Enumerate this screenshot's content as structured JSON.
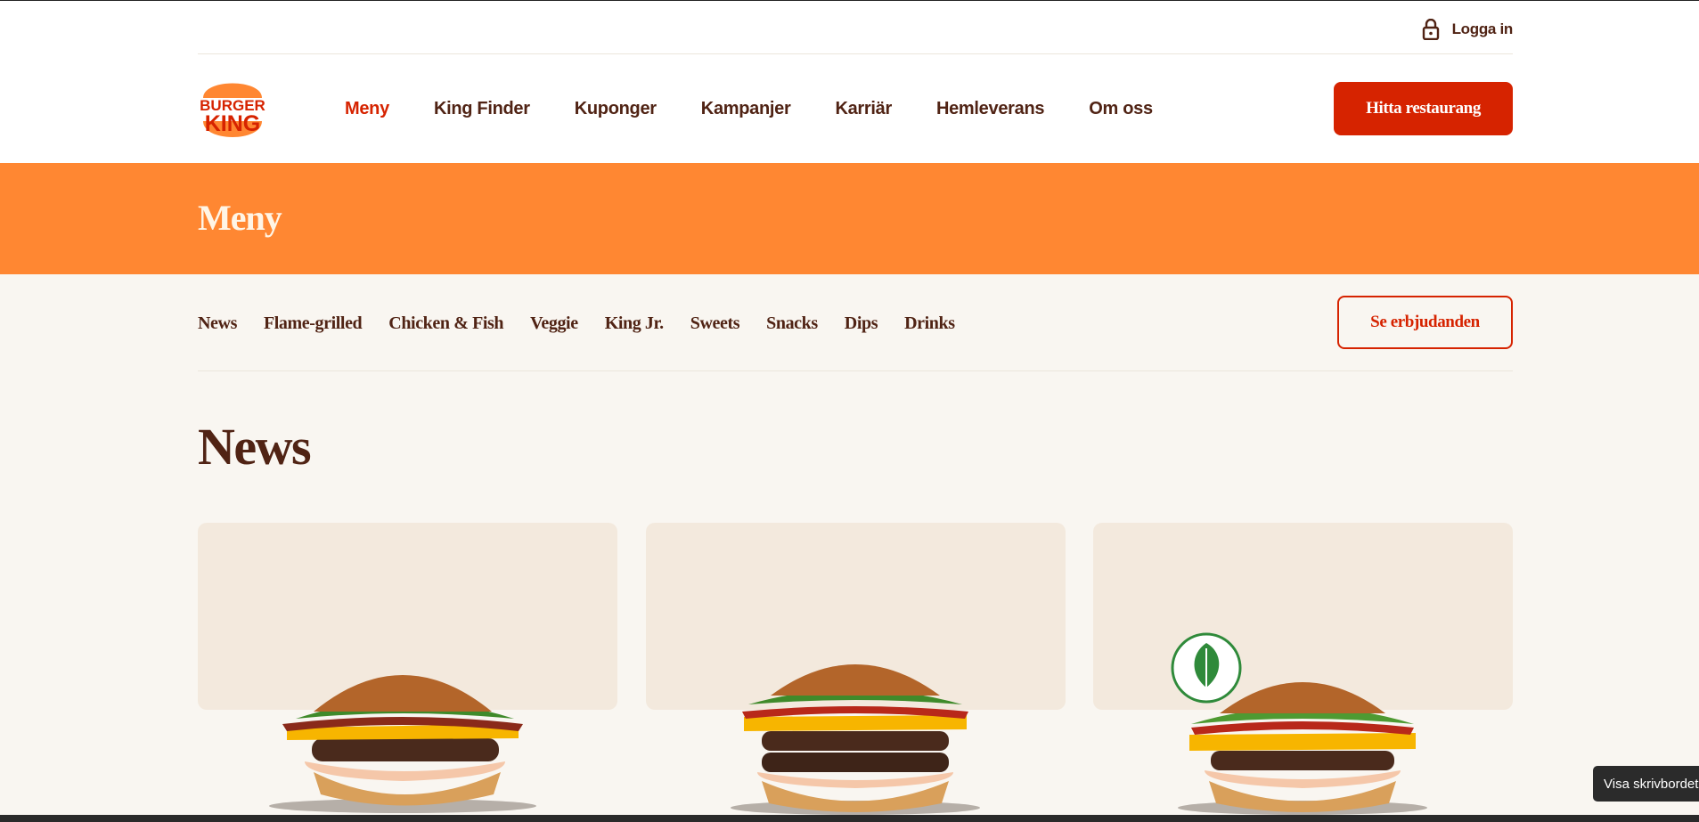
{
  "utility": {
    "login_label": "Logga in"
  },
  "brand": {
    "line1": "BURGER",
    "line2": "KING"
  },
  "nav": {
    "items": [
      {
        "label": "Meny",
        "active": true
      },
      {
        "label": "King Finder",
        "active": false
      },
      {
        "label": "Kuponger",
        "active": false
      },
      {
        "label": "Kampanjer",
        "active": false
      },
      {
        "label": "Karriär",
        "active": false
      },
      {
        "label": "Hemleverans",
        "active": false
      },
      {
        "label": "Om oss",
        "active": false
      }
    ],
    "cta_label": "Hitta restaurang"
  },
  "banner": {
    "title": "Meny"
  },
  "categories": {
    "items": [
      "News",
      "Flame-grilled",
      "Chicken & Fish",
      "Veggie",
      "King Jr.",
      "Sweets",
      "Snacks",
      "Dips",
      "Drinks"
    ],
    "offers_label": "Se erbjudanden"
  },
  "section": {
    "title": "News"
  },
  "products": [
    {
      "image": "bacon-burger-image",
      "badge": null
    },
    {
      "image": "double-bacon-burger-image",
      "badge": null
    },
    {
      "image": "plant-based-burger-image",
      "badge": "Plant-based"
    }
  ],
  "system": {
    "tooltip": "Visa skrivbordet"
  },
  "colors": {
    "brand_red": "#d62300",
    "brand_orange": "#ff8732",
    "brown": "#502314",
    "cream": "#f9f6f1",
    "card": "#f3e9dd"
  }
}
